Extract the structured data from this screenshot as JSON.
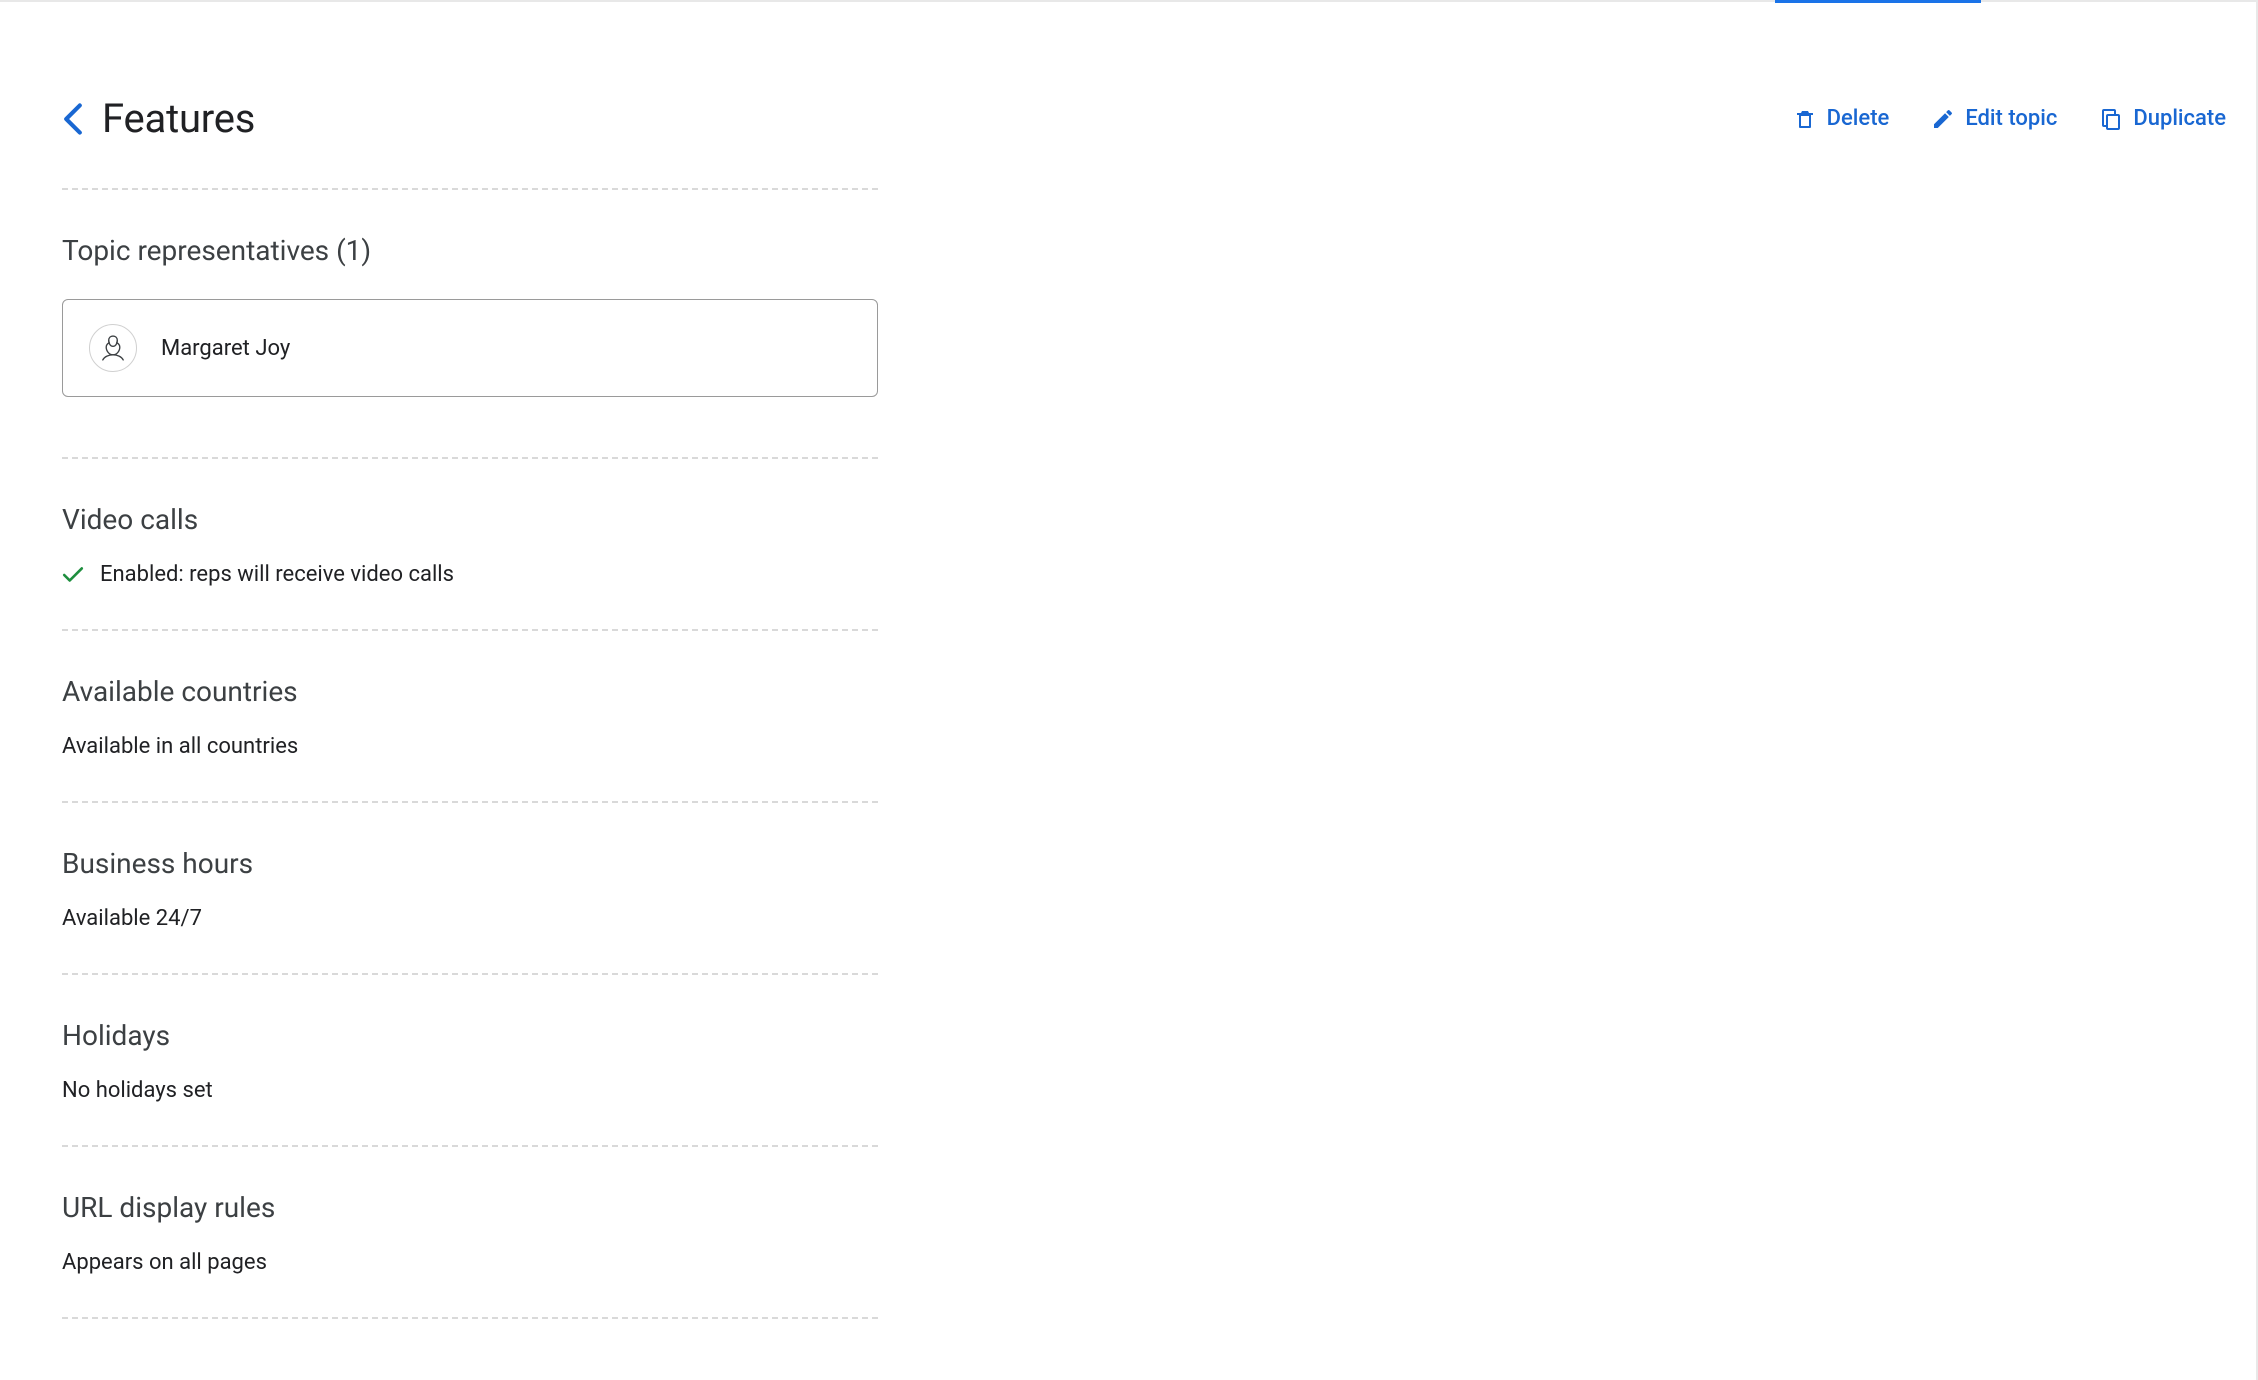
{
  "header": {
    "title": "Features",
    "actions": {
      "delete": "Delete",
      "edit": "Edit topic",
      "duplicate": "Duplicate"
    }
  },
  "sections": {
    "representatives": {
      "title": "Topic representatives (1)",
      "items": [
        {
          "name": "Margaret Joy"
        }
      ]
    },
    "video_calls": {
      "title": "Video calls",
      "status": "Enabled: reps will receive video calls"
    },
    "countries": {
      "title": "Available countries",
      "status": "Available in all countries"
    },
    "hours": {
      "title": "Business hours",
      "status": "Available 24/7"
    },
    "holidays": {
      "title": "Holidays",
      "status": "No holidays set"
    },
    "url_rules": {
      "title": "URL display rules",
      "status": "Appears on all pages"
    }
  }
}
